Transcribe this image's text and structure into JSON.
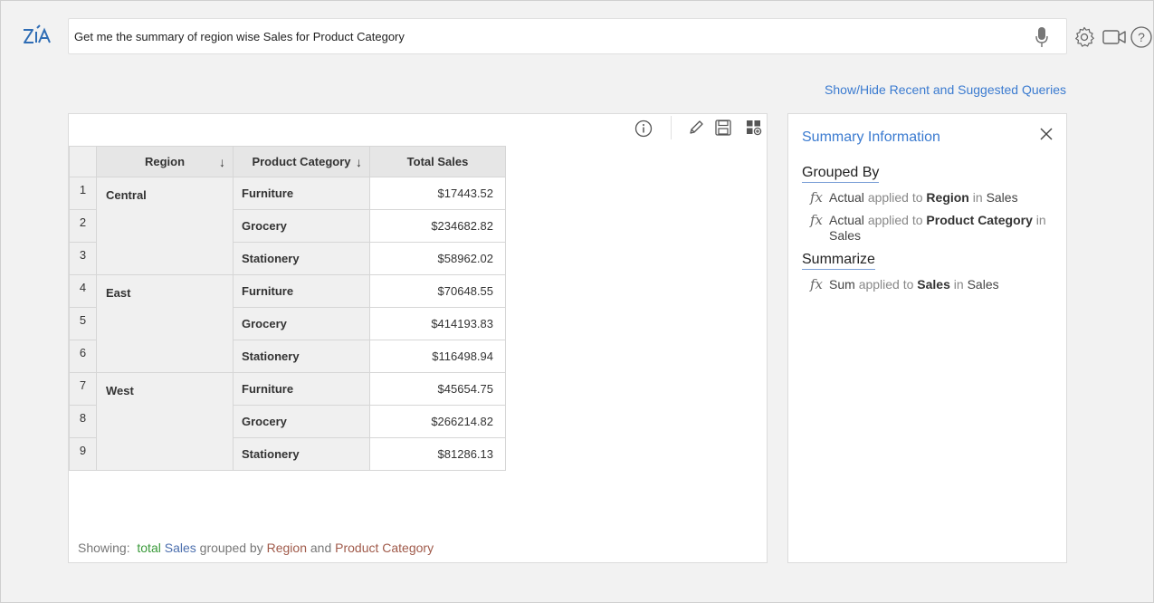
{
  "search": {
    "value": "Get me the summary of region wise Sales for Product Category"
  },
  "suggest_link": "Show/Hide Recent and Suggested Queries",
  "table": {
    "headers": [
      "Region",
      "Product Category",
      "Total Sales"
    ],
    "row_numbers": [
      "1",
      "2",
      "3",
      "4",
      "5",
      "6",
      "7",
      "8",
      "9"
    ],
    "groups": [
      {
        "region": "Central",
        "rows": [
          {
            "category": "Furniture",
            "value": "$17443.52"
          },
          {
            "category": "Grocery",
            "value": "$234682.82"
          },
          {
            "category": "Stationery",
            "value": "$58962.02"
          }
        ]
      },
      {
        "region": "East",
        "rows": [
          {
            "category": "Furniture",
            "value": "$70648.55"
          },
          {
            "category": "Grocery",
            "value": "$414193.83"
          },
          {
            "category": "Stationery",
            "value": "$116498.94"
          }
        ]
      },
      {
        "region": "West",
        "rows": [
          {
            "category": "Furniture",
            "value": "$45654.75"
          },
          {
            "category": "Grocery",
            "value": "$266214.82"
          },
          {
            "category": "Stationery",
            "value": "$81286.13"
          }
        ]
      }
    ]
  },
  "showing": {
    "label": "Showing:",
    "w1": "total",
    "w2": "Sales",
    "w3": "grouped by",
    "w4": "Region",
    "w5": "and",
    "w6": "Product Category"
  },
  "summary": {
    "title": "Summary Information",
    "grouped_by_heading": "Grouped By",
    "summarize_heading": "Summarize",
    "fx_symbol": "fx",
    "grouped": [
      {
        "func": "Actual",
        "applied": "applied to",
        "field": "Region",
        "in": "in",
        "table": "Sales"
      },
      {
        "func": "Actual",
        "applied": "applied to",
        "field": "Product Category",
        "in": "in",
        "table": "Sales"
      }
    ],
    "summarize": [
      {
        "func": "Sum",
        "applied": "applied to",
        "field": "Sales",
        "in": "in",
        "table": "Sales"
      }
    ]
  },
  "colors": {
    "link": "#3b7bd0",
    "total": "#3a9a3a",
    "sales": "#4c6fae",
    "grouping": "#a05a4a"
  }
}
